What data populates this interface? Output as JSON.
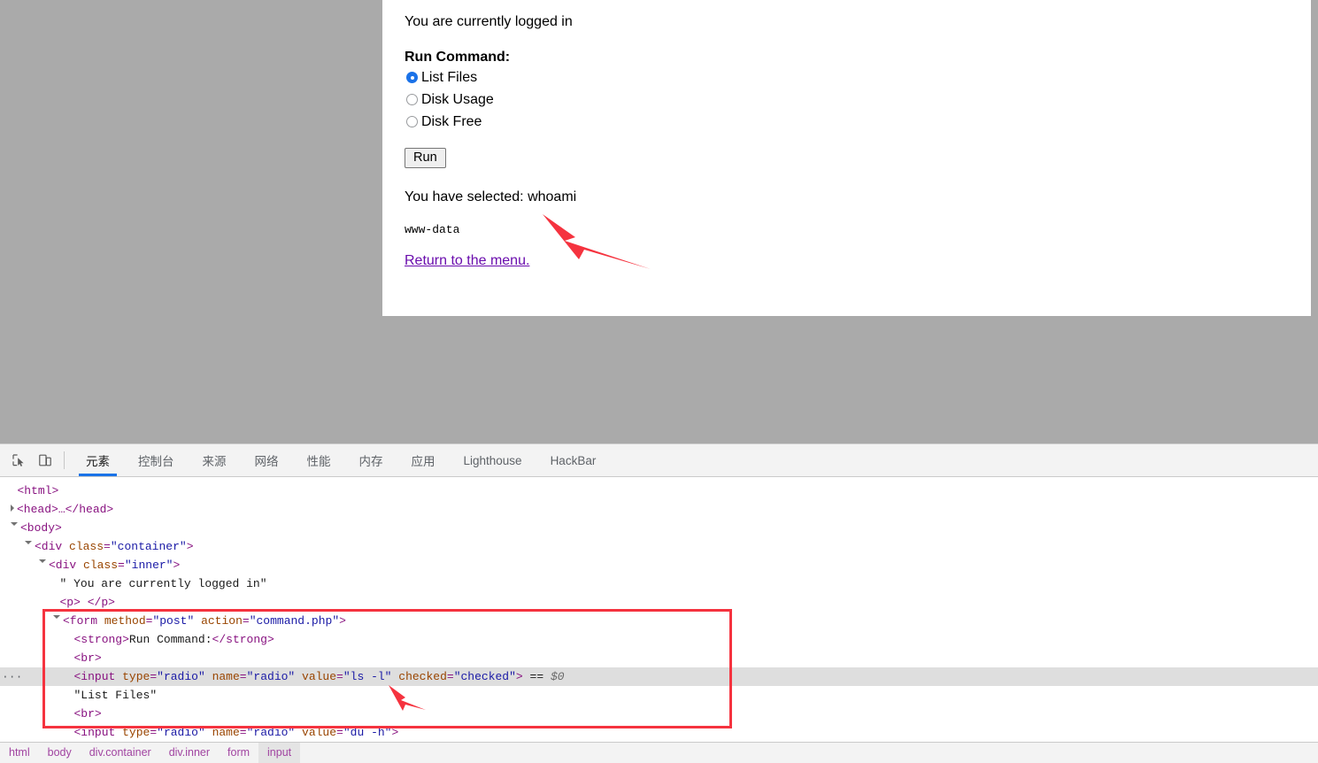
{
  "page": {
    "logged_in_text": "You are currently logged in",
    "form_legend": "Run Command:",
    "options": [
      {
        "label": "List Files",
        "selected": true
      },
      {
        "label": "Disk Usage",
        "selected": false
      },
      {
        "label": "Disk Free",
        "selected": false
      }
    ],
    "run_button": "Run",
    "selected_text": "You have selected: whoami",
    "command_output": "www-data",
    "return_link": "Return to the menu."
  },
  "devtools": {
    "icons": {
      "inspect": "inspect-element-icon",
      "device": "device-toolbar-icon"
    },
    "tabs": [
      {
        "label": "元素",
        "active": true
      },
      {
        "label": "控制台",
        "active": false
      },
      {
        "label": "来源",
        "active": false
      },
      {
        "label": "网络",
        "active": false
      },
      {
        "label": "性能",
        "active": false
      },
      {
        "label": "内存",
        "active": false
      },
      {
        "label": "应用",
        "active": false
      },
      {
        "label": "Lighthouse",
        "active": false
      },
      {
        "label": "HackBar",
        "active": false
      }
    ],
    "dom_rows": [
      {
        "indent": 0,
        "twisty": "none",
        "html": "<span class=\"tag\">&lt;html&gt;</span>"
      },
      {
        "indent": 0,
        "twisty": "closed",
        "html": "<span class=\"tag\">&lt;head&gt;</span><span class=\"ellip\">…</span><span class=\"tag\">&lt;/head&gt;</span>"
      },
      {
        "indent": 0,
        "twisty": "open",
        "html": "<span class=\"tag\">&lt;body&gt;</span>"
      },
      {
        "indent": 1,
        "twisty": "open",
        "html": "<span class=\"tag\">&lt;div</span> <span class=\"attr\">class</span><span class=\"tag\">=</span><span class=\"val\">\"container\"</span><span class=\"tag\">&gt;</span>"
      },
      {
        "indent": 2,
        "twisty": "open",
        "html": "<span class=\"tag\">&lt;div</span> <span class=\"attr\">class</span><span class=\"tag\">=</span><span class=\"val\">\"inner\"</span><span class=\"tag\">&gt;</span>"
      },
      {
        "indent": 3,
        "twisty": "none",
        "html": "<span class=\"txt\">\" You are currently logged in\"</span>"
      },
      {
        "indent": 3,
        "twisty": "none",
        "html": "<span class=\"tag\">&lt;p&gt;</span> <span class=\"tag\">&lt;/p&gt;</span>"
      },
      {
        "indent": 3,
        "twisty": "open",
        "html": "<span class=\"tag\">&lt;form</span> <span class=\"attr\">method</span><span class=\"tag\">=</span><span class=\"val\">\"post\"</span> <span class=\"attr\">action</span><span class=\"tag\">=</span><span class=\"val\">\"command.php\"</span><span class=\"tag\">&gt;</span>"
      },
      {
        "indent": 4,
        "twisty": "none",
        "html": "<span class=\"tag\">&lt;strong&gt;</span><span class=\"txt\">Run Command:</span><span class=\"tag\">&lt;/strong&gt;</span>"
      },
      {
        "indent": 4,
        "twisty": "none",
        "html": "<span class=\"tag\">&lt;br&gt;</span>"
      },
      {
        "indent": 4,
        "twisty": "none",
        "selected": true,
        "dots": "···",
        "html": "<span class=\"tag\">&lt;input</span> <span class=\"attr\">type</span><span class=\"tag\">=</span><span class=\"val\">\"radio\"</span> <span class=\"attr\">name</span><span class=\"tag\">=</span><span class=\"val\">\"radio\"</span> <span class=\"attr\">value</span><span class=\"tag\">=</span><span class=\"val\">\"ls -l\"</span> <span class=\"attr\">checked</span><span class=\"tag\">=</span><span class=\"val\">\"checked\"</span><span class=\"tag\">&gt;</span> <span class=\"txt\">==</span> <span class=\"sel-marker\">$0</span>"
      },
      {
        "indent": 4,
        "twisty": "none",
        "html": "<span class=\"txt\">\"List Files\"</span>"
      },
      {
        "indent": 4,
        "twisty": "none",
        "html": "<span class=\"tag\">&lt;br&gt;</span>"
      },
      {
        "indent": 4,
        "twisty": "none",
        "html": "<span class=\"tag\">&lt;input</span> <span class=\"attr\">type</span><span class=\"tag\">=</span><span class=\"val\">\"radio\"</span> <span class=\"attr\">name</span><span class=\"tag\">=</span><span class=\"val\">\"radio\"</span> <span class=\"attr\">value</span><span class=\"tag\">=</span><span class=\"val\">\"du -h\"</span><span class=\"tag\">&gt;</span>"
      }
    ],
    "breadcrumbs": [
      {
        "label": "html",
        "active": false
      },
      {
        "label": "body",
        "active": false
      },
      {
        "label": "div.container",
        "active": false
      },
      {
        "label": "div.inner",
        "active": false
      },
      {
        "label": "form",
        "active": false
      },
      {
        "label": "input",
        "active": true
      }
    ]
  },
  "annotations": {
    "arrow_color": "#f5333f",
    "highlight_box_color": "#f5333f"
  }
}
